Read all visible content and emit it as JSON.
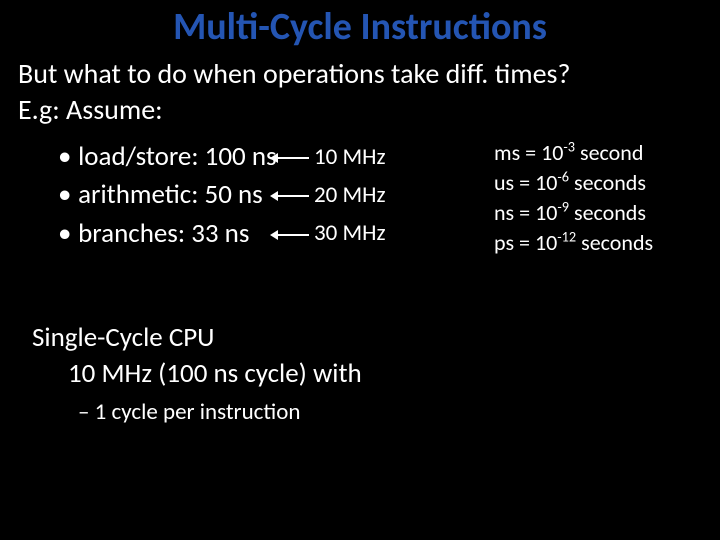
{
  "title": "Multi-Cycle Instructions",
  "intro_line1": "But what to do when operations take diff. times?",
  "intro_line2": "E.g: Assume:",
  "list": {
    "item1": "load/store: 100 ns",
    "item2": "arithmetic: 50 ns",
    "item3": "branches: 33 ns"
  },
  "mhz": {
    "m1": "10 MHz",
    "m2": "20 MHz",
    "m3": "30 MHz"
  },
  "units": {
    "u1_pre": "ms = 10",
    "u1_sup": "-3",
    "u1_post": " second",
    "u2_pre": "us = 10",
    "u2_sup": "-6",
    "u2_post": " seconds",
    "u3_pre": "ns = 10",
    "u3_sup": "-9",
    "u3_post": " seconds",
    "u4_pre": "ps = 10",
    "u4_sup": "-12",
    "u4_post": " seconds"
  },
  "single": {
    "line1": "Single-Cycle CPU",
    "line2": "10 MHz (100 ns cycle) with",
    "sub": "– 1 cycle per instruction"
  }
}
